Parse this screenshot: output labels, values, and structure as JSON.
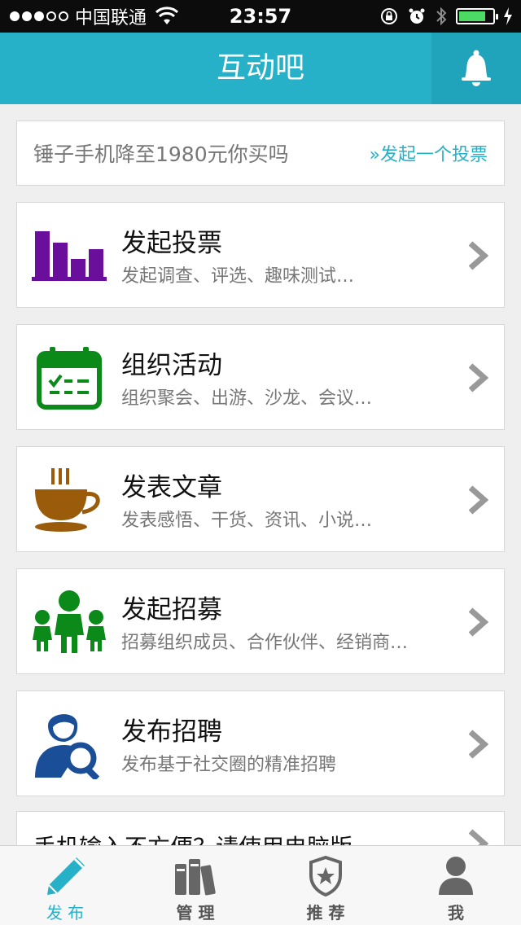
{
  "status_bar": {
    "carrier": "中国联通",
    "time": "23:57"
  },
  "navbar": {
    "title": "互动吧"
  },
  "poll_banner": {
    "question": "锤子手机降至1980元你买吗",
    "link": "»发起一个投票"
  },
  "cards": [
    {
      "title": "发起投票",
      "desc": "发起调查、评选、趣味测试…",
      "icon": "bar-chart-icon",
      "color": "#6a0f9b"
    },
    {
      "title": "组织活动",
      "desc": "组织聚会、出游、沙龙、会议…",
      "icon": "calendar-icon",
      "color": "#0b8a1a"
    },
    {
      "title": "发表文章",
      "desc": "发表感悟、干货、资讯、小说…",
      "icon": "coffee-cup-icon",
      "color": "#9a5c0b"
    },
    {
      "title": "发起招募",
      "desc": "招募组织成员、合作伙伴、经销商…",
      "icon": "people-group-icon",
      "color": "#0b8a1a"
    },
    {
      "title": "发布招聘",
      "desc": "发布基于社交圈的精准招聘",
      "icon": "recruit-search-icon",
      "color": "#1a4f98"
    }
  ],
  "partial_card": {
    "title": "手机输入不方便？请使用电脑版"
  },
  "tabbar": {
    "tabs": [
      {
        "label": "发 布",
        "icon": "pencil-icon",
        "active": true
      },
      {
        "label": "管 理",
        "icon": "books-icon",
        "active": false
      },
      {
        "label": "推 荐",
        "icon": "shield-star-icon",
        "active": false
      },
      {
        "label": "我",
        "icon": "person-icon",
        "active": false
      }
    ]
  },
  "colors": {
    "accent": "#27b1c9",
    "background": "#efefef"
  }
}
